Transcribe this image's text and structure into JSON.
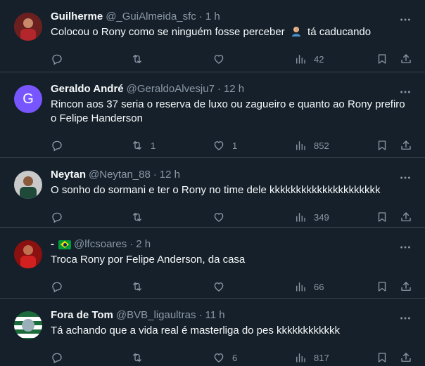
{
  "tweets": [
    {
      "name": "Guilherme",
      "handle": "@_GuiAlmeida_sfc",
      "time": "1 h",
      "text_before": "Colocou o Rony como se ninguém fosse perceber",
      "emoji": "person-facepalming-emoji",
      "text_after": "tá caducando",
      "replies": "",
      "retweets": "",
      "likes": "",
      "views": "42"
    },
    {
      "name": "Geraldo André",
      "handle": "@GeraldoAlvesju7",
      "time": "12 h",
      "avatar_letter": "G",
      "text": "Rincon aos 37 seria o reserva de luxo ou zagueiro e quanto ao Rony prefiro o Felipe Handerson",
      "replies": "",
      "retweets": "1",
      "likes": "1",
      "views": "852"
    },
    {
      "name": "Neytan",
      "handle": "@Neytan_88",
      "time": "12 h",
      "text": "O sonho do sormani e ter o Rony no time dele kkkkkkkkkkkkkkkkkkkkk",
      "replies": "",
      "retweets": "",
      "likes": "",
      "views": "349"
    },
    {
      "name": "-",
      "handle": "@lfcsoares",
      "time": "2 h",
      "text": "Troca Rony por Felipe Anderson, da casa",
      "replies": "",
      "retweets": "",
      "likes": "",
      "views": "66"
    },
    {
      "name": "Fora de Tom",
      "handle": "@BVB_ligaultras",
      "time": "11 h",
      "text": "Tá achando que a vida real é masterliga do pes kkkkkkkkkkkk",
      "replies": "",
      "retweets": "",
      "likes": "6",
      "views": "817"
    }
  ],
  "separator": "·",
  "colors": {
    "background": "#15202b",
    "divider": "#38444d",
    "secondary_text": "#8b98a5",
    "primary_text": "#f7f9f9",
    "avatar_letter_bg": "#7856ff"
  }
}
